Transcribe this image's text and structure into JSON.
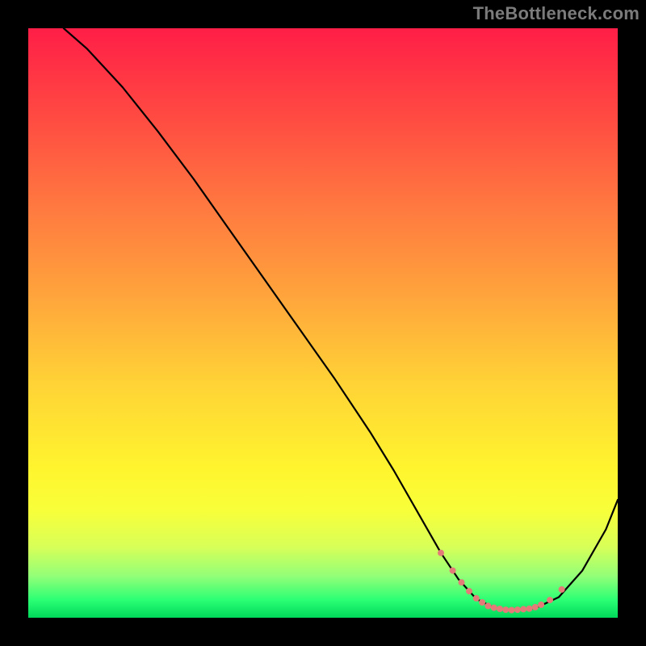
{
  "watermark": "TheBottleneck.com",
  "chart_data": {
    "type": "line",
    "title": "",
    "xlabel": "",
    "ylabel": "",
    "xlim": [
      0,
      100
    ],
    "ylim": [
      0,
      100
    ],
    "grid": false,
    "series": [
      {
        "name": "bottleneck-curve",
        "x": [
          6,
          10,
          16,
          22,
          28,
          34,
          40,
          46,
          52,
          58,
          62,
          66,
          70,
          73,
          76,
          79,
          82,
          86,
          90,
          94,
          98,
          100
        ],
        "y": [
          100,
          96.5,
          90,
          82.5,
          74.5,
          66,
          57.5,
          49,
          40.5,
          31.5,
          25,
          18,
          11,
          6.5,
          3.2,
          1.7,
          1.3,
          1.6,
          3.5,
          8,
          15,
          20
        ],
        "color": "#000000"
      }
    ],
    "markers": {
      "name": "optimal-range",
      "color": "#e37b78",
      "points": [
        {
          "x": 70,
          "y": 11
        },
        {
          "x": 72,
          "y": 8
        },
        {
          "x": 73.5,
          "y": 6
        },
        {
          "x": 74.8,
          "y": 4.5
        },
        {
          "x": 76,
          "y": 3.3
        },
        {
          "x": 77,
          "y": 2.6
        },
        {
          "x": 78,
          "y": 2.0
        },
        {
          "x": 79,
          "y": 1.7
        },
        {
          "x": 80,
          "y": 1.5
        },
        {
          "x": 81,
          "y": 1.35
        },
        {
          "x": 82,
          "y": 1.3
        },
        {
          "x": 83,
          "y": 1.35
        },
        {
          "x": 84,
          "y": 1.45
        },
        {
          "x": 85,
          "y": 1.55
        },
        {
          "x": 86,
          "y": 1.8
        },
        {
          "x": 87,
          "y": 2.2
        },
        {
          "x": 88.5,
          "y": 3.0
        },
        {
          "x": 90.5,
          "y": 4.8
        }
      ]
    }
  }
}
